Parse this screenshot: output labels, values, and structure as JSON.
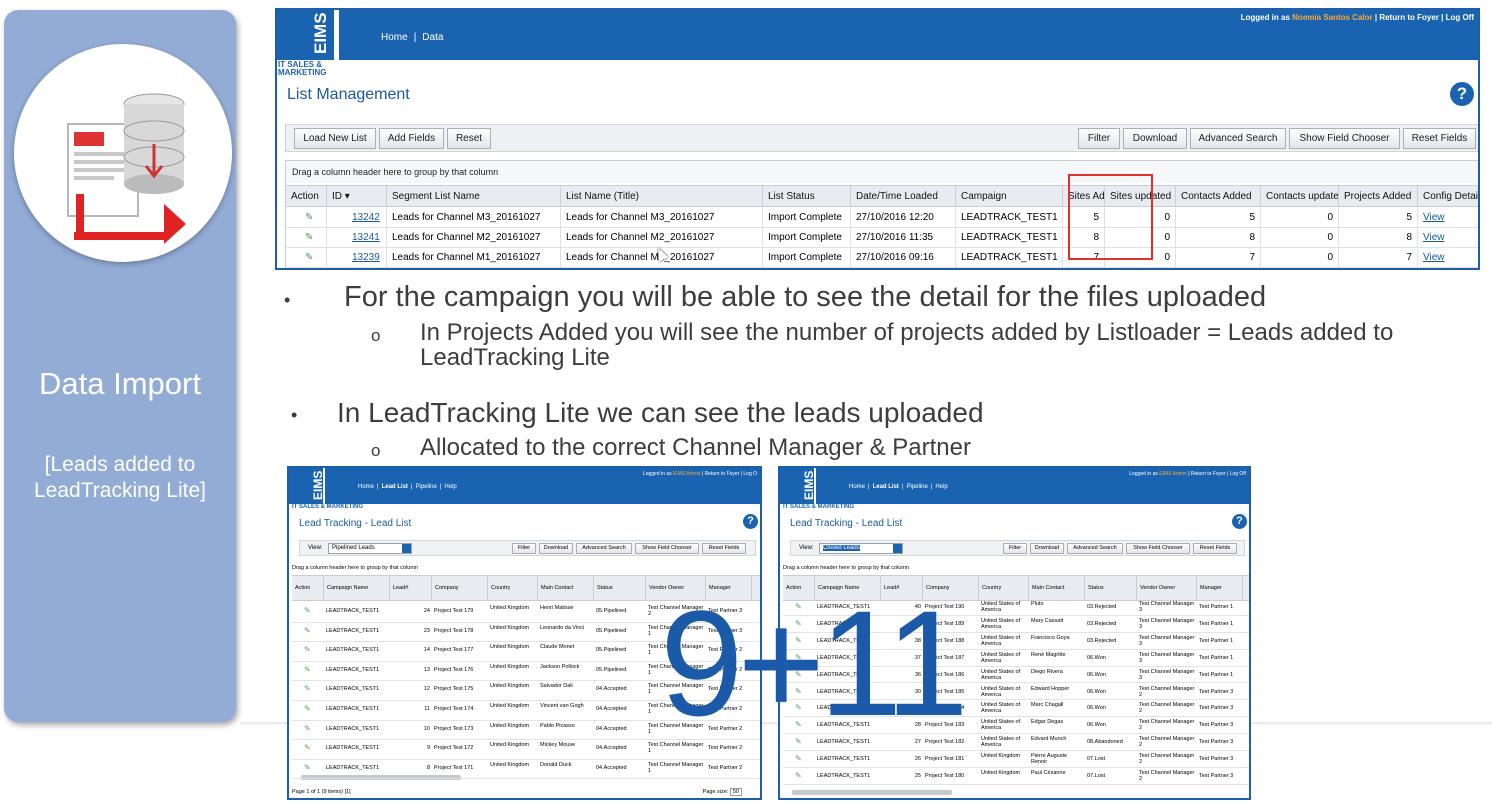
{
  "sidebar": {
    "title": "Data Import",
    "subtitle": "[Leads added to LeadTracking Lite]"
  },
  "app": {
    "logo": "EIMS",
    "logo_sub": "IT SALES & MARKETING",
    "nav": [
      "Home",
      "Data"
    ],
    "login_prefix": "Logged in as",
    "user": "Noemia Santos Calor",
    "login_links": "| Return to Foyer | Log Off",
    "title": "List Management",
    "help": "?",
    "buttons_left": [
      "Load New List",
      "Add Fields",
      "Reset"
    ],
    "buttons_right": [
      "Filter",
      "Download",
      "Advanced Search",
      "Show Field Chooser",
      "Reset Fields"
    ],
    "group_hint": "Drag a column header here to group by that column",
    "columns": [
      "Action",
      "ID",
      "Segment List Name",
      "List Name (Title)",
      "List Status",
      "Date/Time Loaded",
      "Campaign",
      "Sites Add",
      "Sites updated",
      "Contacts Added",
      "Contacts updated",
      "Projects Added",
      "Config Details"
    ],
    "rows": [
      {
        "id": "13242",
        "segment": "Leads for Channel M3_20161027",
        "list": "Leads for Channel M3_20161027",
        "status": "Import Complete",
        "date": "27/10/2016 12:20",
        "campaign": "LEADTRACK_TEST1",
        "sites_add": "5",
        "sites_upd": "0",
        "contacts_add": "5",
        "contacts_upd": "0",
        "projects": "5",
        "config": "View"
      },
      {
        "id": "13241",
        "segment": "Leads for Channel M2_20161027",
        "list": "Leads for Channel M2_20161027",
        "status": "Import Complete",
        "date": "27/10/2016 11:35",
        "campaign": "LEADTRACK_TEST1",
        "sites_add": "8",
        "sites_upd": "0",
        "contacts_add": "8",
        "contacts_upd": "0",
        "projects": "8",
        "config": "View"
      },
      {
        "id": "13239",
        "segment": "Leads for Channel M1_20161027",
        "list": "Leads for Channel M1_20161027",
        "status": "Import Complete",
        "date": "27/10/2016 09:16",
        "campaign": "LEADTRACK_TEST1",
        "sites_add": "7",
        "sites_upd": "0",
        "contacts_add": "7",
        "contacts_upd": "0",
        "projects": "7",
        "config": "View"
      }
    ]
  },
  "bullets": {
    "b1": "For the campaign you will be able to see the detail for the files uploaded",
    "b1_sub": "In Projects Added you will see the number of projects added by Listloader = Leads added to LeadTracking Lite",
    "b2": "In LeadTracking Lite we can see the leads uploaded",
    "b2_sub": "Allocated to the correct Channel Manager & Partner",
    "bullet": "•",
    "sub_bullet": "o"
  },
  "shot1": {
    "logo": "EIMS",
    "logo_sub": "IT SALES & MARKETING",
    "nav": [
      "Home",
      "Lead List",
      "Pipeline",
      "Help"
    ],
    "login_prefix": "Logged in as",
    "user": "EIMS Admin",
    "login_links": "| Return to Foyer | Log O",
    "title": "Lead Tracking - Lead List",
    "view_label": "View:",
    "view_value": "Pipelined Leads",
    "buttons": [
      "Filter",
      "Download",
      "Advanced Search",
      "Show Field Chooser",
      "Reset Fields"
    ],
    "group_hint": "Drag a column header here to group by that column",
    "columns": [
      "Action",
      "Campaign Name",
      "Lead#",
      "Company",
      "Country",
      "Main Contact",
      "Status",
      "Vendor Owner",
      "Manager"
    ],
    "rows": [
      [
        "LEADTRACK_TEST1",
        "24",
        "Project Test 179",
        "United Kingdom",
        "Henri Matisse",
        "05.Pipelined",
        "Test Channel Manager 2",
        "Test Partner 3"
      ],
      [
        "LEADTRACK_TEST1",
        "23",
        "Project Test 178",
        "United Kingdom",
        "Leonardo da Vinci",
        "05.Pipelined",
        "Test Channel Manager 1",
        "Test Partner 3"
      ],
      [
        "LEADTRACK_TEST1",
        "14",
        "Project Test 177",
        "United Kingdom",
        "Claude Monet",
        "05.Pipelined",
        "Test Channel Manager 1",
        "Test Partner 2"
      ],
      [
        "LEADTRACK_TEST1",
        "13",
        "Project Test 176",
        "United Kingdom",
        "Jackson Pollock",
        "05.Pipelined",
        "Test Channel Manager 1",
        "Test Partner 2"
      ],
      [
        "LEADTRACK_TEST1",
        "12",
        "Project Test 175",
        "United Kingdom",
        "Salvador Dali",
        "04.Accepted",
        "Test Channel Manager 1",
        "Test Partner 2"
      ],
      [
        "LEADTRACK_TEST1",
        "11",
        "Project Test 174",
        "United Kingdom",
        "Vincent van Gogh",
        "04.Accepted",
        "Test Channel Manager 1",
        "Test Partner 2"
      ],
      [
        "LEADTRACK_TEST1",
        "10",
        "Project Test 173",
        "United Kingdom",
        "Pablo Picasso",
        "04.Accepted",
        "Test Channel Manager 1",
        "Test Partner 2"
      ],
      [
        "LEADTRACK_TEST1",
        "9",
        "Project Test 172",
        "United Kingdom",
        "Mickey Mouse",
        "04.Accepted",
        "Test Channel Manager 1",
        "Test Partner 2"
      ],
      [
        "LEADTRACK_TEST1",
        "8",
        "Project Test 171",
        "United Kingdom",
        "Donald Duck",
        "04.Accepted",
        "Test Channel Manager 1",
        "Test Partner 2"
      ]
    ],
    "footer": "Page 1 of 1 (9 items) [1]",
    "page_size_label": "Page size:",
    "page_size": "50"
  },
  "shot2": {
    "logo": "EIMS",
    "logo_sub": "IT SALES & MARKETING",
    "nav": [
      "Home",
      "Lead List",
      "Pipeline",
      "Help"
    ],
    "login_prefix": "Logged in as",
    "user": "EIMS Admin",
    "login_links": "| Return to Foyer | Log Off",
    "title": "Lead Tracking - Lead List",
    "view_label": "View:",
    "view_value": "Closed Leads",
    "buttons": [
      "Filter",
      "Download",
      "Advanced Search",
      "Show Field Chooser",
      "Reset Fields"
    ],
    "group_hint": "Drag a column header here to group by that column",
    "columns": [
      "Action",
      "Campaign Name",
      "Lead#",
      "Company",
      "Country",
      "Main Contact",
      "Status",
      "Vendor Owner",
      "Manager"
    ],
    "rows": [
      [
        "LEADTRACK_TEST1",
        "40",
        "Project Test 190",
        "United States of America",
        "Pluto",
        "03.Rejected",
        "Test Channel Manager 3",
        "Test Partner 1"
      ],
      [
        "LEADTRACK_TEST1",
        "39",
        "Project Test 189",
        "United States of America",
        "Mary Cassatt",
        "03.Rejected",
        "Test Channel Manager 3",
        "Test Partner 1"
      ],
      [
        "LEADTRACK_TEST1",
        "38",
        "Project Test 188",
        "United States of America",
        "Francisco Goya",
        "03.Rejected",
        "Test Channel Manager 3",
        "Test Partner 1"
      ],
      [
        "LEADTRACK_TEST1",
        "37",
        "Project Test 187",
        "United States of America",
        "René Magritte",
        "06.Won",
        "Test Channel Manager 3",
        "Test Partner 1"
      ],
      [
        "LEADTRACK_TEST1",
        "36",
        "Project Test 186",
        "United States of America",
        "Diego Rivera",
        "06.Won",
        "Test Channel Manager 3",
        "Test Partner 1"
      ],
      [
        "LEADTRACK_TEST1",
        "30",
        "Project Test 185",
        "United States of America",
        "Edward Hopper",
        "06.Won",
        "Test Channel Manager 2",
        "Test Partner 3"
      ],
      [
        "LEADTRACK_TEST1",
        "29",
        "Project Test 184",
        "United States of America",
        "Marc Chagall",
        "06.Won",
        "Test Channel Manager 2",
        "Test Partner 3"
      ],
      [
        "LEADTRACK_TEST1",
        "28",
        "Project Test 183",
        "United States of America",
        "Edgar Degas",
        "06.Won",
        "Test Channel Manager 2",
        "Test Partner 3"
      ],
      [
        "LEADTRACK_TEST1",
        "27",
        "Project Test 182",
        "United States of America",
        "Edvard Munch",
        "08.Abandoned",
        "Test Channel Manager 2",
        "Test Partner 3"
      ],
      [
        "LEADTRACK_TEST1",
        "26",
        "Project Test 181",
        "United Kingdom",
        "Pierre Auguste Renoir",
        "07.Lost",
        "Test Channel Manager 2",
        "Test Partner 3"
      ],
      [
        "LEADTRACK_TEST1",
        "25",
        "Project Test 180",
        "United Kingdom",
        "Paul Cézanne",
        "07.Lost",
        "Test Channel Manager 2",
        "Test Partner 3"
      ]
    ]
  },
  "overlay": "9+11"
}
